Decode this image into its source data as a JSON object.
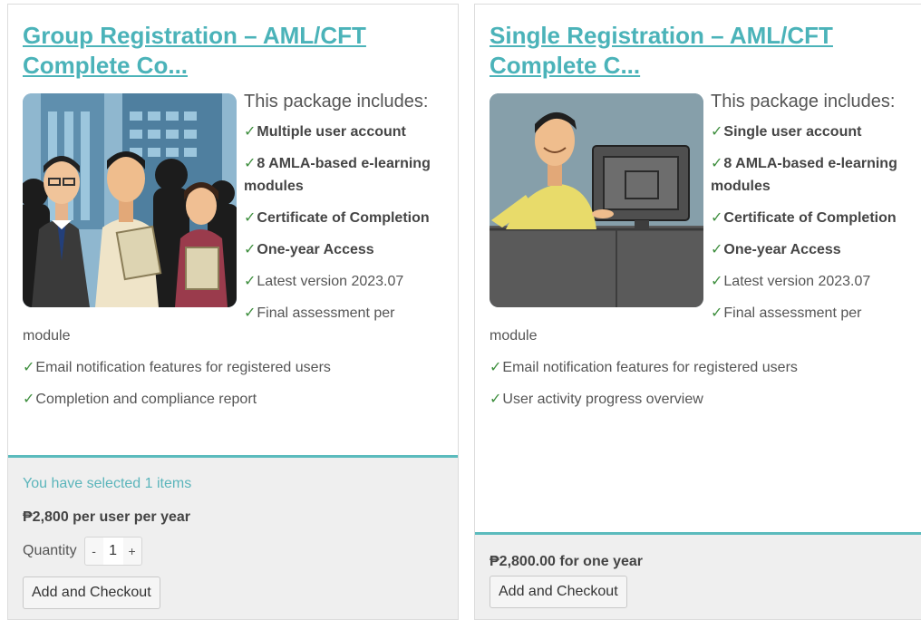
{
  "accent_color": "#4bb3b9",
  "check_icon": "check-icon",
  "cards": [
    {
      "title": "Group Registration – AML/CFT Complete Co...",
      "image": "group-professionals-illustration",
      "intro": "This package includes:",
      "features": [
        {
          "text": "Multiple user account",
          "bold": true
        },
        {
          "text": "8 AMLA-based e-learning modules",
          "bold": true
        },
        {
          "text": "Certificate of Completion",
          "bold": true
        },
        {
          "text": "One-year Access",
          "bold": true
        },
        {
          "text": "Latest version 2023.07",
          "bold": false
        },
        {
          "text": "Final assessment per module",
          "bold": false
        },
        {
          "text": "Email notification features for registered users",
          "bold": false
        },
        {
          "text": "Completion and compliance report",
          "bold": false
        }
      ],
      "selected_note": "You have selected 1 items",
      "price": "₱2,800 per user per year",
      "quantity_label": "Quantity",
      "quantity_value": "1",
      "decrement_label": "-",
      "increment_label": "+",
      "checkout_label": "Add and Checkout"
    },
    {
      "title": "Single Registration – AML/CFT Complete C...",
      "image": "single-user-computer-illustration",
      "intro": "This package includes:",
      "features": [
        {
          "text": "Single user account",
          "bold": true
        },
        {
          "text": "8 AMLA-based e-learning modules",
          "bold": true
        },
        {
          "text": "Certificate of Completion",
          "bold": true
        },
        {
          "text": "One-year Access",
          "bold": true
        },
        {
          "text": "Latest version 2023.07",
          "bold": false
        },
        {
          "text": "Final assessment per module",
          "bold": false
        },
        {
          "text": "Email notification features for registered users",
          "bold": false
        },
        {
          "text": "User activity progress overview",
          "bold": false
        }
      ],
      "price": "₱2,800.00 for one year",
      "checkout_label": "Add and Checkout"
    }
  ]
}
